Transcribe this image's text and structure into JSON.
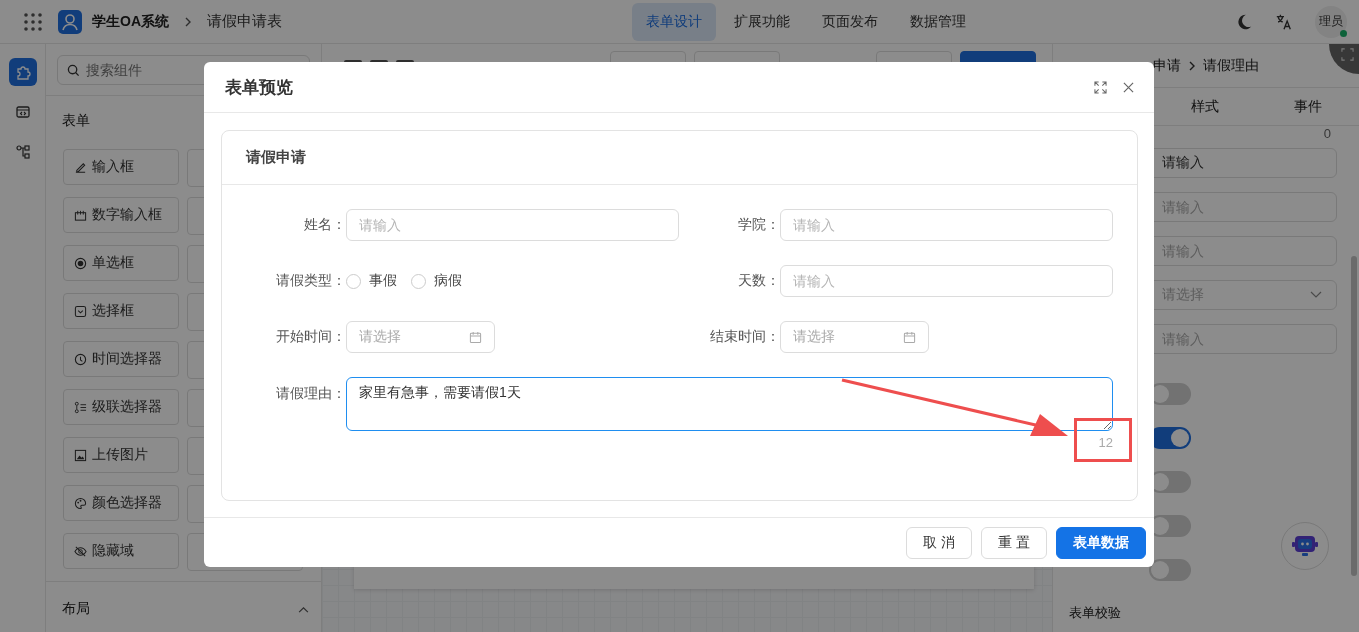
{
  "header": {
    "app_name": "学生OA系统",
    "page_title": "请假申请表",
    "nav": [
      {
        "label": "表单设计",
        "selected": true
      },
      {
        "label": "扩展功能",
        "selected": false
      },
      {
        "label": "页面发布",
        "selected": false
      },
      {
        "label": "数据管理",
        "selected": false
      }
    ],
    "avatar": {
      "text": "理员",
      "online": true
    }
  },
  "rail": [
    {
      "kind": "puzzle",
      "selected": true
    },
    {
      "kind": "code",
      "selected": false
    },
    {
      "kind": "tree",
      "selected": false
    }
  ],
  "palette": {
    "search": {
      "placeholder": "搜索组件"
    },
    "section": "表单",
    "items": [
      {
        "label": "输入框",
        "kind": "input"
      },
      {
        "label": "数字输入框",
        "kind": "number"
      },
      {
        "label": "单选框",
        "kind": "radio"
      },
      {
        "label": "选择框",
        "kind": "select"
      },
      {
        "label": "时间选择器",
        "kind": "time"
      },
      {
        "label": "级联选择器",
        "kind": "cascader"
      },
      {
        "label": "上传图片",
        "kind": "upload"
      },
      {
        "label": "颜色选择器",
        "kind": "color"
      },
      {
        "label": "隐藏域",
        "kind": "hidden"
      }
    ],
    "layout_section": {
      "title": "布局",
      "expanded": true
    }
  },
  "properties": {
    "breadcrumb": [
      "申请",
      "请假理由"
    ],
    "tabs": [
      "样式",
      "事件"
    ],
    "count": "0",
    "fields": [
      {
        "kind": "input",
        "value": "请输入"
      },
      {
        "kind": "input",
        "placeholder": "请输入"
      },
      {
        "kind": "input",
        "placeholder": "请输入"
      },
      {
        "kind": "select",
        "placeholder": "请选择"
      },
      {
        "kind": "input",
        "placeholder": "请输入"
      }
    ],
    "switches": [
      {
        "on": false
      },
      {
        "on": true
      },
      {
        "on": false
      },
      {
        "on": false
      },
      {
        "on": false
      }
    ],
    "section_label": "表单校验"
  },
  "modal": {
    "title": "表单预览",
    "card_title": "请假申请",
    "fields": [
      {
        "kind": "input",
        "label": "姓名：",
        "placeholder": "请输入"
      },
      {
        "kind": "input",
        "label": "学院：",
        "placeholder": "请输入"
      },
      {
        "kind": "radio",
        "label": "请假类型：",
        "options": [
          {
            "label": "事假",
            "selected": false
          },
          {
            "label": "病假",
            "selected": false
          }
        ]
      },
      {
        "kind": "input",
        "label": "天数：",
        "placeholder": "请输入"
      },
      {
        "kind": "date",
        "label": "开始时间：",
        "placeholder": "请选择"
      },
      {
        "kind": "date",
        "label": "结束时间：",
        "placeholder": "请选择"
      },
      {
        "kind": "textarea",
        "label": "请假理由：",
        "value": "家里有急事，需要请假1天",
        "focused": true
      }
    ],
    "counter": "12",
    "buttons": [
      {
        "label": "取 消",
        "kind": "default"
      },
      {
        "label": "重 置",
        "kind": "default"
      },
      {
        "label": "表单数据",
        "kind": "primary"
      }
    ]
  }
}
